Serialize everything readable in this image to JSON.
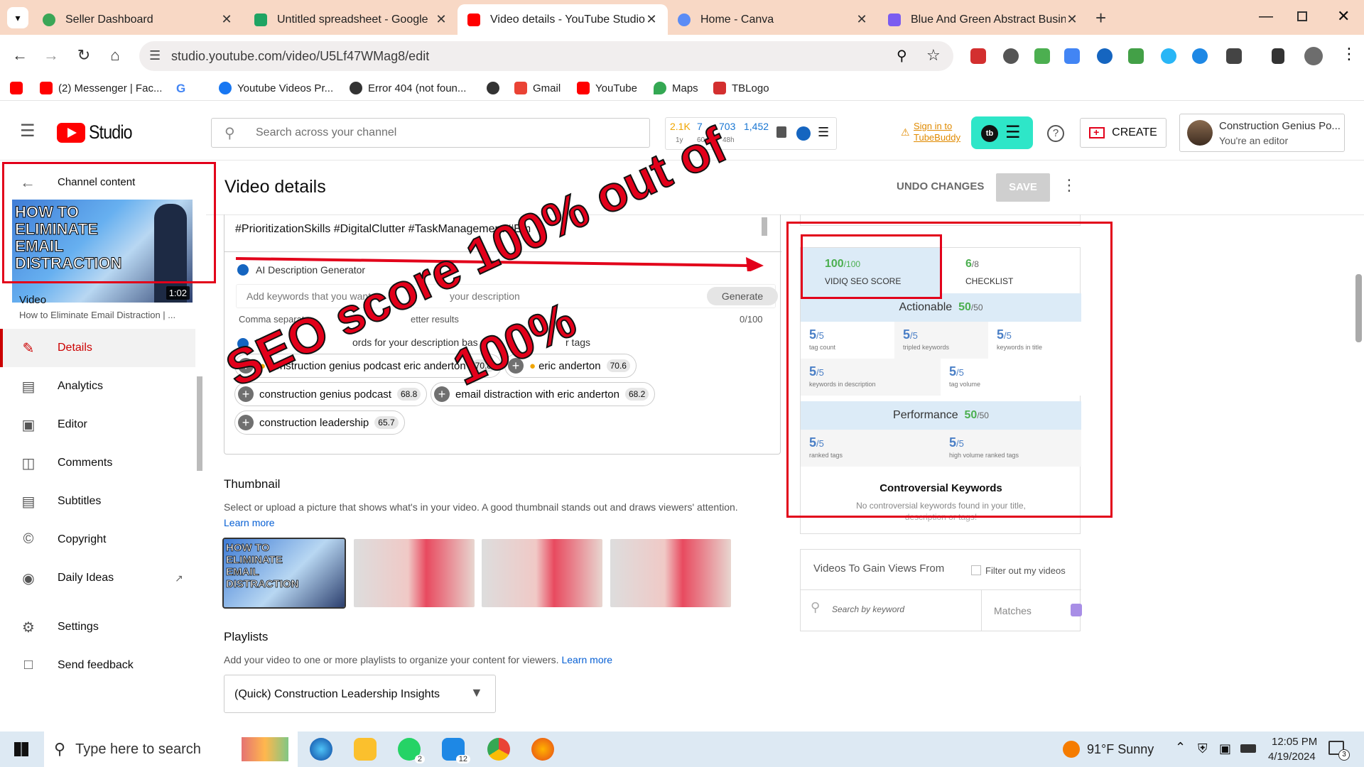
{
  "browser": {
    "tabs": [
      {
        "title": "Seller Dashboard",
        "color": "#3aa657"
      },
      {
        "title": "Untitled spreadsheet - Google",
        "color": "#1fa463"
      },
      {
        "title": "Video details - YouTube Studio",
        "color": "#ff0000"
      },
      {
        "title": "Home - Canva",
        "color": "#5b8cf5"
      },
      {
        "title": "Blue And Green Abstract Busin",
        "color": "#7b5cf0"
      }
    ],
    "new_tab": "+",
    "url": "studio.youtube.com/video/U5Lf47WMag8/edit",
    "bookmarks": [
      {
        "label": "",
        "color": "#ff0000"
      },
      {
        "label": "(2) Messenger | Fac...",
        "color": "#ff0000"
      },
      {
        "label": "G",
        "color": "#4285f4"
      },
      {
        "label": "Youtube Videos Pr...",
        "color": "#1877f2"
      },
      {
        "label": "Error 404 (not foun...",
        "color": "#333333"
      },
      {
        "label": "",
        "color": "#333333"
      },
      {
        "label": "Gmail",
        "color": "#ea4335"
      },
      {
        "label": "YouTube",
        "color": "#ff0000"
      },
      {
        "label": "Maps",
        "color": "#34a853"
      },
      {
        "label": "TBLogo",
        "color": "#d32f2f"
      }
    ]
  },
  "studio": {
    "logo": "Studio",
    "search_placeholder": "Search across your channel",
    "stats": {
      "a": "2.1K",
      "a_sub": "1y",
      "b": "7",
      "b_sub": "60m",
      "c": "703",
      "c_sub": "48h",
      "d": "1,452",
      "d_sub": ""
    },
    "tubebuddy": {
      "line1": "Sign in to",
      "line2": "TubeBuddy"
    },
    "create": "CREATE",
    "account": {
      "name": "Construction Genius Po...",
      "role": "You're an editor"
    }
  },
  "sidebar": {
    "back": "Channel content",
    "thumb_title": "HOW TO ELIMINATE EMAIL DISTRACTION",
    "duration": "1:02",
    "video_label": "Video",
    "video_title": "How to Eliminate Email Distraction | ...",
    "items": [
      {
        "label": "Details",
        "icon": "pencil-icon"
      },
      {
        "label": "Analytics",
        "icon": "analytics-icon"
      },
      {
        "label": "Editor",
        "icon": "editor-icon"
      },
      {
        "label": "Comments",
        "icon": "comments-icon"
      },
      {
        "label": "Subtitles",
        "icon": "subtitles-icon"
      },
      {
        "label": "Copyright",
        "icon": "copyright-icon"
      },
      {
        "label": "Daily Ideas",
        "icon": "daily-ideas-icon"
      },
      {
        "label": "Settings",
        "icon": "gear-icon"
      },
      {
        "label": "Send feedback",
        "icon": "feedback-icon"
      }
    ]
  },
  "main": {
    "title": "Video details",
    "undo": "UNDO CHANGES",
    "save": "SAVE",
    "hashtags": "#PrioritizationSkills #DigitalClutter #TaskManagement #Em",
    "ai_label": "AI Description Generator",
    "ai_placeholder": "Add keywords that you want t",
    "ai_placeholder_tail": "your description",
    "generate": "Generate",
    "comma_hint": "Comma separat",
    "comma_hint_tail": "etter results",
    "counter": "0/100",
    "rec_label": "R",
    "rec_tail": "ords for your description bas",
    "rec_tail2": "r tags",
    "chips": [
      {
        "label": "construction genius podcast eric anderton",
        "score": "70.8"
      },
      {
        "label": "eric anderton",
        "score": "70.6"
      },
      {
        "label": "construction genius podcast",
        "score": "68.8"
      },
      {
        "label": "email distraction with eric anderton",
        "score": "68.2"
      },
      {
        "label": "construction leadership",
        "score": "65.7"
      }
    ],
    "thumbnail_heading": "Thumbnail",
    "thumbnail_desc": "Select or upload a picture that shows what's in your video. A good thumbnail stands out and draws viewers' attention.",
    "learn_more": "Learn more",
    "playlists_heading": "Playlists",
    "playlists_desc": "Add your video to one or more playlists to organize your content for viewers.",
    "playlist_value": "(Quick) Construction Leadership Insights"
  },
  "vidiq": {
    "seo_score": "100",
    "seo_max": "/100",
    "seo_label": "VIDIQ SEO SCORE",
    "checklist_score": "6",
    "checklist_max": "/8",
    "checklist_label": "CHECKLIST",
    "actionable_label": "Actionable",
    "actionable_score": "50",
    "actionable_max": "/50",
    "actionable_items": [
      {
        "v": "5",
        "label": "tag count"
      },
      {
        "v": "5",
        "label": "tripled keywords"
      },
      {
        "v": "5",
        "label": "keywords in title"
      },
      {
        "v": "5",
        "label": "keywords in description"
      },
      {
        "v": "5",
        "label": "tag volume"
      }
    ],
    "performance_label": "Performance",
    "performance_score": "50",
    "performance_max": "/50",
    "performance_items": [
      {
        "v": "5",
        "label": "ranked tags"
      },
      {
        "v": "5",
        "label": "high volume ranked tags"
      }
    ],
    "item_max": "/5",
    "controversial_title": "Controversial Keywords",
    "controversial_desc": "No controversial keywords found in your title,",
    "controversial_desc2": "description or tags!",
    "gain_title": "Videos To Gain Views From",
    "filter_label": "Filter out my videos",
    "search_placeholder": "Search by keyword",
    "matches": "Matches"
  },
  "overlay": {
    "line1": "SEO score 100% out of",
    "line2": "100%"
  },
  "taskbar": {
    "search": "Type here to search",
    "weather": "91°F  Sunny",
    "time": "12:05 PM",
    "date": "4/19/2024",
    "notif": "3",
    "badge_whatsapp": "2",
    "badge_mail": "12"
  }
}
